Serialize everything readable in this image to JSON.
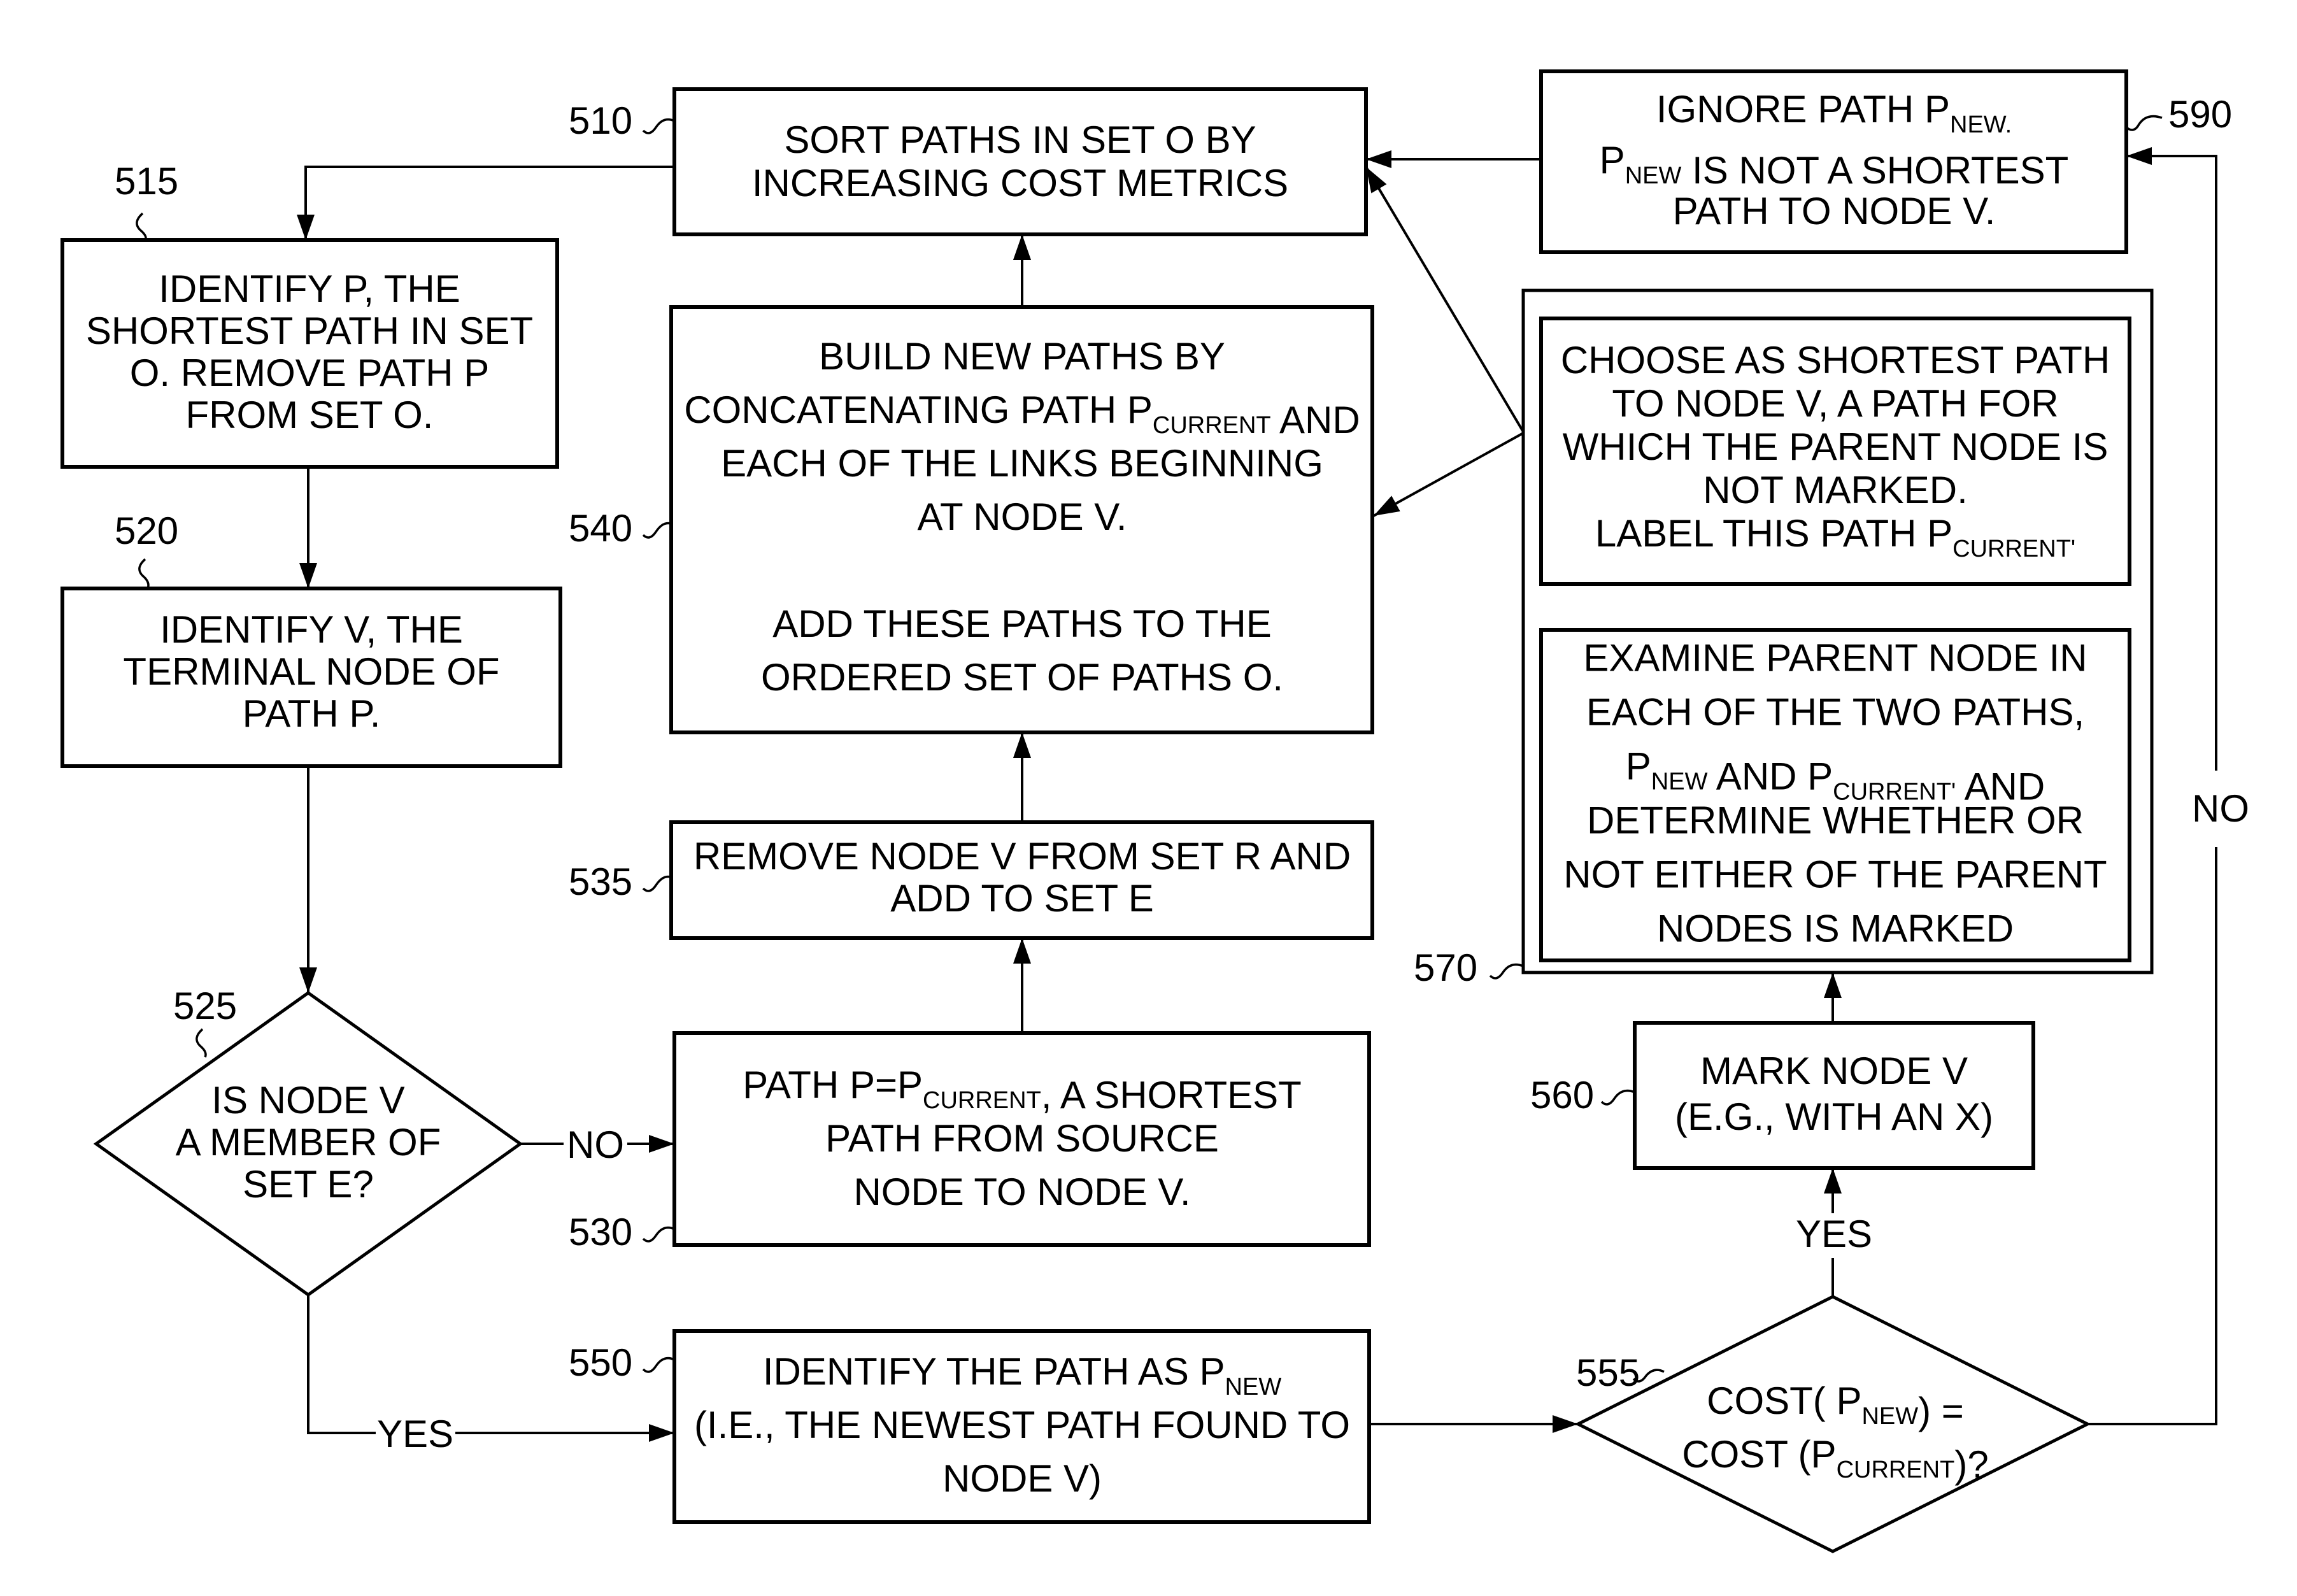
{
  "figure": {
    "type": "flowchart",
    "title": ""
  },
  "nodes": {
    "n510": {
      "ref": "510",
      "lines": [
        [
          {
            "t": "SORT PATHS IN SET O BY"
          }
        ],
        [
          {
            "t": "INCREASING COST METRICS"
          }
        ]
      ]
    },
    "n515": {
      "ref": "515",
      "lines": [
        [
          {
            "t": "IDENTIFY P, THE"
          }
        ],
        [
          {
            "t": "SHORTEST PATH IN SET"
          }
        ],
        [
          {
            "t": "O.  REMOVE PATH P"
          }
        ],
        [
          {
            "t": "FROM SET O."
          }
        ]
      ]
    },
    "n520": {
      "ref": "520",
      "lines": [
        [
          {
            "t": "IDENTIFY V, THE"
          }
        ],
        [
          {
            "t": "TERMINAL NODE OF"
          }
        ],
        [
          {
            "t": "PATH  P."
          }
        ]
      ]
    },
    "n525": {
      "ref": "525",
      "lines": [
        [
          {
            "t": "IS NODE V"
          }
        ],
        [
          {
            "t": "A MEMBER OF"
          }
        ],
        [
          {
            "t": "SET E?"
          }
        ]
      ]
    },
    "n530": {
      "ref": "530",
      "lines": [
        [
          {
            "t": "PATH P=P"
          },
          {
            "t": "CURRENT",
            "sub": true
          },
          {
            "t": ", A SHORTEST"
          }
        ],
        [
          {
            "t": "PATH FROM SOURCE"
          }
        ],
        [
          {
            "t": "NODE TO NODE V."
          }
        ]
      ]
    },
    "n535": {
      "ref": "535",
      "lines": [
        [
          {
            "t": "REMOVE NODE V FROM SET R AND"
          }
        ],
        [
          {
            "t": "ADD TO SET E"
          }
        ]
      ]
    },
    "n540": {
      "ref": "540",
      "lines": [
        [
          {
            "t": "BUILD NEW PATHS  BY"
          }
        ],
        [
          {
            "t": "CONCATENATING PATH P"
          },
          {
            "t": "CURRENT",
            "sub": true
          },
          {
            "t": " AND"
          }
        ],
        [
          {
            "t": "EACH  OF THE LINKS BEGINNING"
          }
        ],
        [
          {
            "t": "AT NODE  V."
          }
        ],
        [
          {
            "t": ""
          }
        ],
        [
          {
            "t": "ADD THESE PATHS TO THE"
          }
        ],
        [
          {
            "t": "ORDERED SET OF PATHS O."
          }
        ]
      ]
    },
    "n550": {
      "ref": "550",
      "lines": [
        [
          {
            "t": "IDENTIFY THE PATH AS P"
          },
          {
            "t": "NEW",
            "sub": true
          }
        ],
        [
          {
            "t": "(I.E., THE NEWEST PATH FOUND TO"
          }
        ],
        [
          {
            "t": "NODE V)"
          }
        ]
      ]
    },
    "n555": {
      "ref": "555",
      "lines": [
        [
          {
            "t": "COST( P"
          },
          {
            "t": "NEW",
            "sub": true
          },
          {
            "t": ") ="
          }
        ],
        [
          {
            "t": "COST (P"
          },
          {
            "t": "CURRENT",
            "sub": true
          },
          {
            "t": ")?"
          }
        ]
      ]
    },
    "n560": {
      "ref": "560",
      "lines": [
        [
          {
            "t": "MARK NODE V"
          }
        ],
        [
          {
            "t": "(E.G., WITH AN  X)"
          }
        ]
      ]
    },
    "n570": {
      "ref": "570",
      "choose_lines": [
        [
          {
            "t": "CHOOSE AS SHORTEST PATH"
          }
        ],
        [
          {
            "t": "TO NODE V, A PATH FOR"
          }
        ],
        [
          {
            "t": "WHICH THE PARENT NODE IS"
          }
        ],
        [
          {
            "t": "NOT MARKED."
          }
        ],
        [
          {
            "t": "LABEL THIS PATH P"
          },
          {
            "t": "CURRENT'",
            "sub": true
          }
        ]
      ],
      "examine_lines": [
        [
          {
            "t": "EXAMINE PARENT NODE IN"
          }
        ],
        [
          {
            "t": "EACH OF THE TWO PATHS,"
          }
        ],
        [
          {
            "t": "P"
          },
          {
            "t": "NEW",
            "sub": true
          },
          {
            "t": " AND P"
          },
          {
            "t": "CURRENT'",
            "sub": true
          },
          {
            "t": " AND"
          }
        ],
        [
          {
            "t": "DETERMINE WHETHER OR"
          }
        ],
        [
          {
            "t": "NOT EITHER OF THE PARENT"
          }
        ],
        [
          {
            "t": "NODES IS MARKED"
          }
        ]
      ]
    },
    "n590": {
      "ref": "590",
      "lines": [
        [
          {
            "t": "IGNORE PATH P"
          },
          {
            "t": "NEW.",
            "sub": true
          }
        ],
        [
          {
            "t": "P"
          },
          {
            "t": "NEW",
            "sub": true
          },
          {
            "t": " IS NOT A SHORTEST"
          }
        ],
        [
          {
            "t": "PATH TO NODE V."
          }
        ]
      ]
    }
  },
  "branch_labels": {
    "no_525": "NO",
    "yes_525": "YES",
    "yes_555": "YES",
    "no_555": "NO"
  },
  "edges": [
    {
      "from": "510",
      "to": "515"
    },
    {
      "from": "515",
      "to": "520"
    },
    {
      "from": "520",
      "to": "525"
    },
    {
      "from": "525",
      "to": "530",
      "label": "NO"
    },
    {
      "from": "525",
      "to": "550",
      "label": "YES"
    },
    {
      "from": "530",
      "to": "535"
    },
    {
      "from": "535",
      "to": "540"
    },
    {
      "from": "540",
      "to": "510"
    },
    {
      "from": "550",
      "to": "555"
    },
    {
      "from": "555",
      "to": "560",
      "label": "YES"
    },
    {
      "from": "555",
      "to": "590",
      "label": "NO"
    },
    {
      "from": "560",
      "to": "570"
    },
    {
      "from": "570",
      "to": "510"
    },
    {
      "from": "570",
      "to": "540"
    },
    {
      "from": "590",
      "to": "510"
    }
  ]
}
